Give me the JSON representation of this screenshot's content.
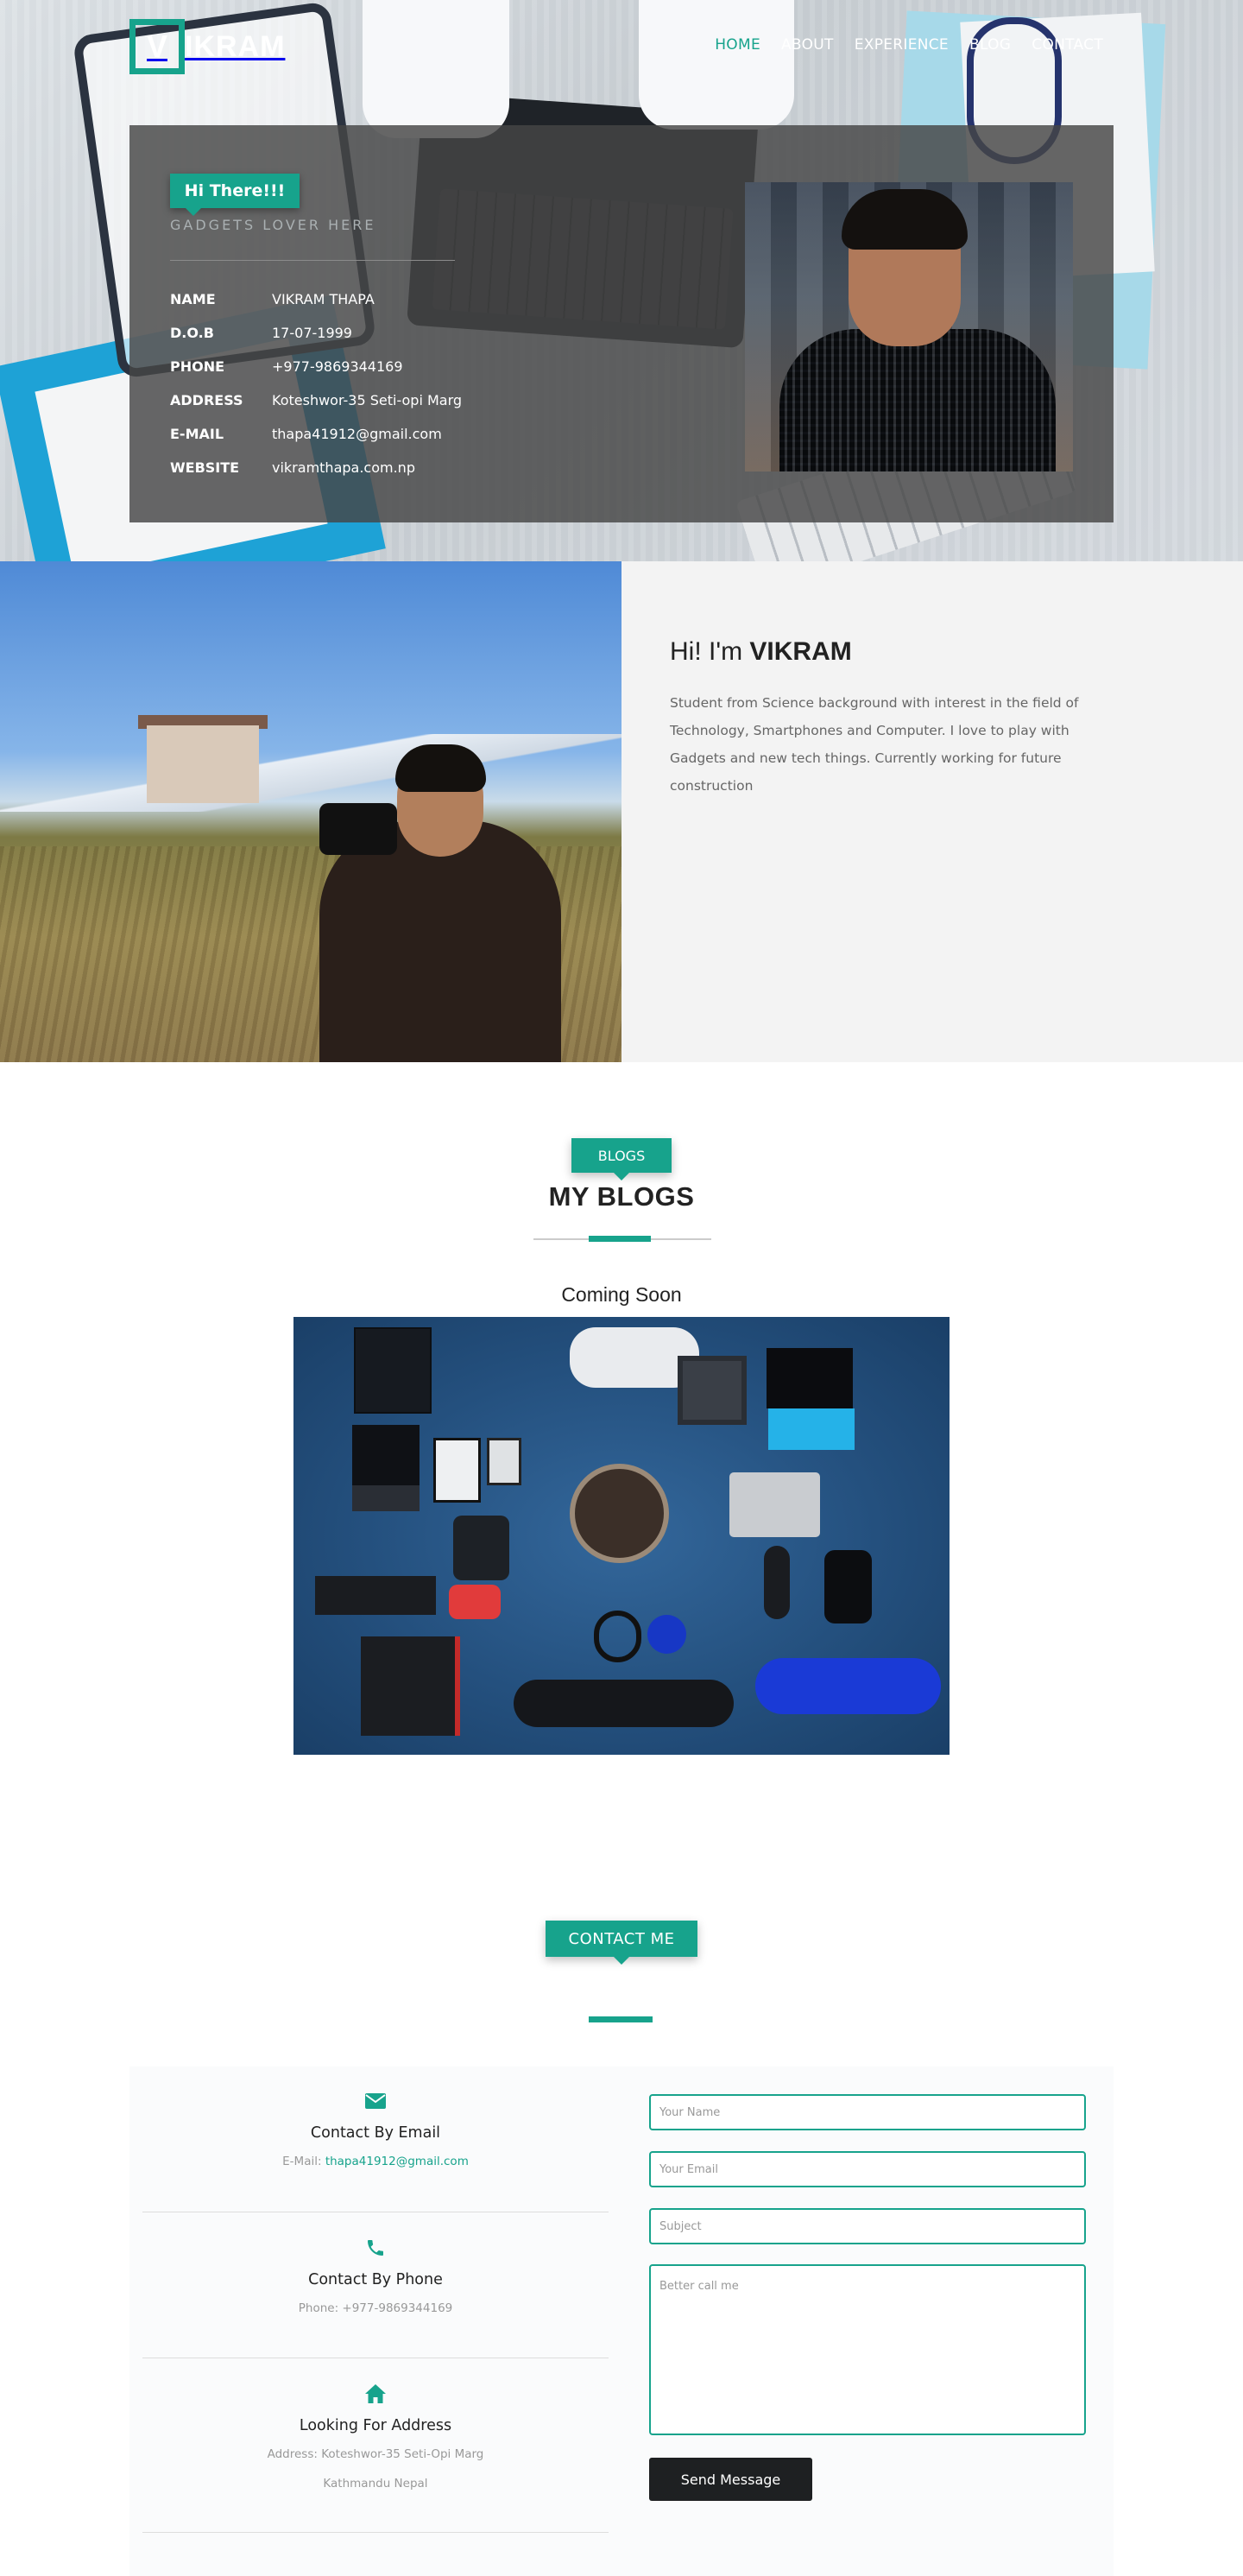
{
  "nav": {
    "logo_letter": "V",
    "logo_text": "IKRAM",
    "items": [
      {
        "label": "HOME",
        "active": true
      },
      {
        "label": "ABOUT",
        "active": false
      },
      {
        "label": "EXPERIENCE",
        "active": false
      },
      {
        "label": "BLOG",
        "active": false
      },
      {
        "label": "CONTACT",
        "active": false
      }
    ]
  },
  "profile": {
    "badge": "Hi There!!!",
    "tagline": "GADGETS LOVER HERE",
    "rows": [
      {
        "key": "NAME",
        "value": "VIKRAM THAPA"
      },
      {
        "key": "D.O.B",
        "value": "17-07-1999"
      },
      {
        "key": "PHONE",
        "value": "+977-9869344169"
      },
      {
        "key": "ADDRESS",
        "value": "Koteshwor-35 Seti-opi Marg"
      },
      {
        "key": "E-MAIL",
        "value": "thapa41912@gmail.com"
      },
      {
        "key": "WEBSITE",
        "value": "vikramthapa.com.np"
      }
    ]
  },
  "about": {
    "greeting": "Hi! I'm",
    "name": "VIKRAM",
    "description": "Student from Science background with interest in the field of Technology, Smartphones and Computer. I love to play with Gadgets and new tech things. Currently working for future construction"
  },
  "blogs": {
    "badge": "BLOGS",
    "heading_light": "MY",
    "heading_bold": "BLOGS",
    "coming_soon": "Coming Soon"
  },
  "contact": {
    "badge": "CONTACT ME",
    "email_title": "Contact By Email",
    "email_prefix": "E-Mail:",
    "email_value": "thapa41912@gmail.com",
    "phone_title": "Contact By Phone",
    "phone_line": "Phone: +977-9869344169",
    "address_title": "Looking For Address",
    "address_line1": "Address: Koteshwor-35 Seti-Opi Marg",
    "address_line2": "Kathmandu Nepal",
    "form": {
      "name_placeholder": "Your Name",
      "email_placeholder": "Your Email",
      "subject_placeholder": "Subject",
      "message_placeholder": "Better call me",
      "send_label": "Send Message"
    }
  },
  "colors": {
    "accent": "#17a38c",
    "dark_button": "#1e2022",
    "card_overlay": "#464646"
  },
  "icons": [
    "envelope-icon",
    "phone-icon",
    "home-icon"
  ]
}
